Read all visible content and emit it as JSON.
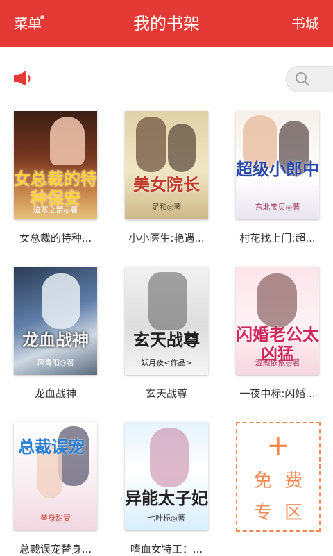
{
  "header": {
    "menu_label": "菜单",
    "title": "我的书架",
    "store_label": "书城",
    "bg_color": "#e53935"
  },
  "toolbar": {
    "announce_icon": "megaphone-icon",
    "search_icon": "search-icon"
  },
  "books": [
    {
      "label": "女总裁的特种...",
      "cover_title": "女总裁的特种保安",
      "cover_author": "迫寒之箭◎著"
    },
    {
      "label": "小小医生:艳遇...",
      "cover_title": "美女院长",
      "cover_author": "足和◎著"
    },
    {
      "label": "村花找上门:超...",
      "cover_title": "超级小郎中",
      "cover_author": "东北宝贝◎著"
    },
    {
      "label": "龙血战神",
      "cover_title": "龙血战神",
      "cover_author": "风青阳◎著"
    },
    {
      "label": "玄天战尊",
      "cover_title": "玄天战尊",
      "cover_author": "妖月夜<作品>"
    },
    {
      "label": "一夜中标:闪婚...",
      "cover_title": "闪婚老公太凶猛",
      "cover_author": "温煦依依◎著"
    },
    {
      "label": "总裁误宠替身...",
      "cover_title": "总裁误宠",
      "cover_author": "替身甜妻"
    },
    {
      "label": "嗜血女特工：...",
      "cover_title": "异能太子妃",
      "cover_author": "七叶栀◎著"
    }
  ],
  "free_zone": {
    "plus": "+",
    "line1": "免费",
    "line2": "专区",
    "color": "#f28a52"
  }
}
